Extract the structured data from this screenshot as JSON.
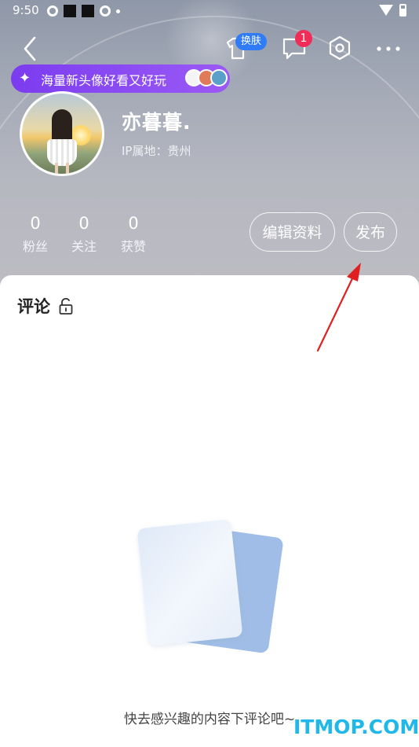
{
  "status_bar": {
    "time": "9:50"
  },
  "header": {
    "skin_badge": "换肤",
    "notification_count": "1"
  },
  "promo": {
    "text": "海量新头像好看又好玩"
  },
  "profile": {
    "username": "亦暮暮.",
    "ip_location": "IP属地：贵州"
  },
  "stats": [
    {
      "value": "0",
      "label": "粉丝"
    },
    {
      "value": "0",
      "label": "关注"
    },
    {
      "value": "0",
      "label": "获赞"
    }
  ],
  "actions": {
    "edit_profile": "编辑资料",
    "publish": "发布"
  },
  "comments": {
    "title": "评论",
    "empty_text": "快去感兴趣的内容下评论吧~"
  },
  "watermark": "ITMOP.COM",
  "colors": {
    "accent_blue": "#2f7cf6",
    "badge_red": "#ef2d56",
    "promo_purple": "#8a4bf2",
    "arrow_red": "#e02020"
  }
}
